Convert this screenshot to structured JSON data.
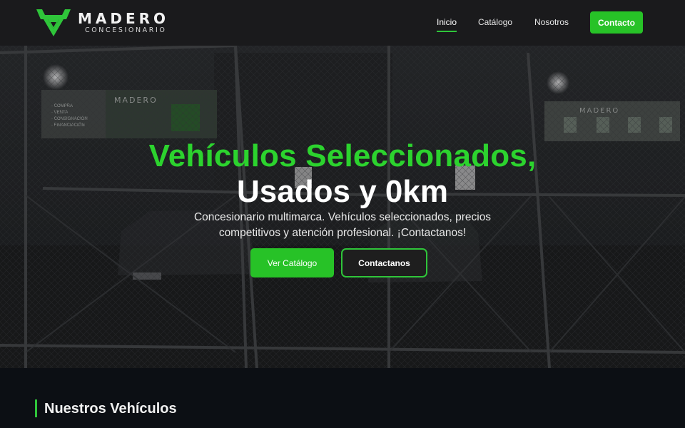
{
  "brand": {
    "name": "MADERO",
    "subtitle": "CONCESIONARIO",
    "accent": "#2fc53a"
  },
  "nav": {
    "items": [
      {
        "label": "Inicio",
        "active": true
      },
      {
        "label": "Catálogo",
        "active": false
      },
      {
        "label": "Nosotros",
        "active": false
      }
    ],
    "cta_label": "Contacto"
  },
  "hero": {
    "title_line1": "Vehículos Seleccionados,",
    "title_line2": "Usados y 0km",
    "subtitle": "Concesionario multimarca. Vehículos seleccionados, precios competitivos y atención profesional. ¡Contactanos!",
    "primary_button": "Ver Catálogo",
    "secondary_button": "Contactanos",
    "banner_left": {
      "brand": "MADERO",
      "list": [
        "COMPRA",
        "VENTA",
        "CONSIGNACIÓN",
        "FINANCIACIÓN"
      ]
    },
    "banner_right": {
      "brand": "MADERO"
    }
  },
  "section": {
    "title": "Nuestros Vehículos"
  }
}
